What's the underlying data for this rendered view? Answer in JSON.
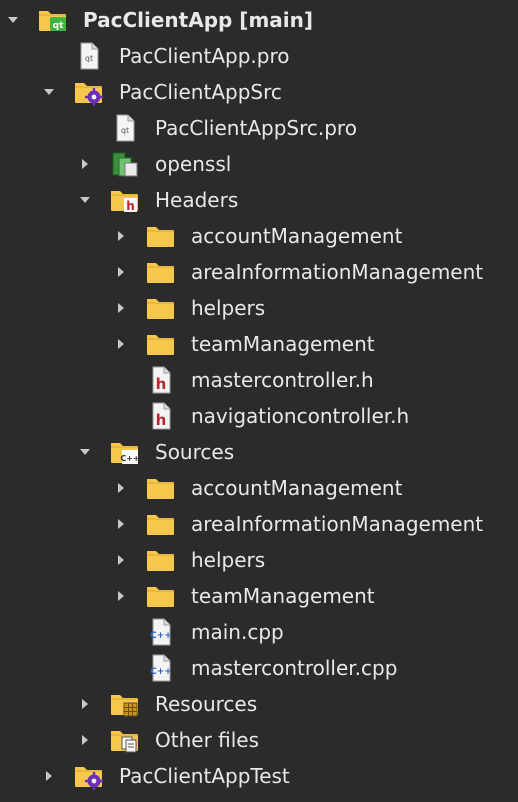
{
  "tree": [
    {
      "label": "PacClientApp [main]",
      "level": 0,
      "arrow": "expanded",
      "icon": "qt-project-folder-icon",
      "bold": true
    },
    {
      "label": "PacClientApp.pro",
      "level": 1,
      "arrow": "none",
      "icon": "qt-pro-file-icon"
    },
    {
      "label": "PacClientAppSrc",
      "level": 1,
      "arrow": "expanded",
      "icon": "subproject-folder-icon"
    },
    {
      "label": "PacClientAppSrc.pro",
      "level": 2,
      "arrow": "none",
      "icon": "qt-pro-file-icon"
    },
    {
      "label": "openssl",
      "level": 2,
      "arrow": "collapsed",
      "icon": "library-icon"
    },
    {
      "label": "Headers",
      "level": 2,
      "arrow": "expanded",
      "icon": "headers-folder-icon"
    },
    {
      "label": "accountManagement",
      "level": 3,
      "arrow": "collapsed",
      "icon": "folder-icon"
    },
    {
      "label": "areaInformationManagement",
      "level": 3,
      "arrow": "collapsed",
      "icon": "folder-icon"
    },
    {
      "label": "helpers",
      "level": 3,
      "arrow": "collapsed",
      "icon": "folder-icon"
    },
    {
      "label": "teamManagement",
      "level": 3,
      "arrow": "collapsed",
      "icon": "folder-icon"
    },
    {
      "label": "mastercontroller.h",
      "level": 3,
      "arrow": "none",
      "icon": "header-file-icon"
    },
    {
      "label": "navigationcontroller.h",
      "level": 3,
      "arrow": "none",
      "icon": "header-file-icon"
    },
    {
      "label": "Sources",
      "level": 2,
      "arrow": "expanded",
      "icon": "sources-folder-icon"
    },
    {
      "label": "accountManagement",
      "level": 3,
      "arrow": "collapsed",
      "icon": "folder-icon"
    },
    {
      "label": "areaInformationManagement",
      "level": 3,
      "arrow": "collapsed",
      "icon": "folder-icon"
    },
    {
      "label": "helpers",
      "level": 3,
      "arrow": "collapsed",
      "icon": "folder-icon"
    },
    {
      "label": "teamManagement",
      "level": 3,
      "arrow": "collapsed",
      "icon": "folder-icon"
    },
    {
      "label": "main.cpp",
      "level": 3,
      "arrow": "none",
      "icon": "cpp-file-icon"
    },
    {
      "label": "mastercontroller.cpp",
      "level": 3,
      "arrow": "none",
      "icon": "cpp-file-icon"
    },
    {
      "label": "Resources",
      "level": 2,
      "arrow": "collapsed",
      "icon": "resources-folder-icon"
    },
    {
      "label": "Other files",
      "level": 2,
      "arrow": "collapsed",
      "icon": "other-files-folder-icon"
    },
    {
      "label": "PacClientAppTest",
      "level": 1,
      "arrow": "collapsed",
      "icon": "subproject-folder-icon"
    }
  ],
  "colors": {
    "background": "#2b2b2b",
    "text": "#e8e8e8",
    "arrow": "#c8c8c8",
    "folder": "#f5c84c",
    "qt_green": "#41b541",
    "header_red": "#b8282c",
    "cpp_blue": "#2a62c2",
    "gear_purple": "#6a2fb6"
  }
}
